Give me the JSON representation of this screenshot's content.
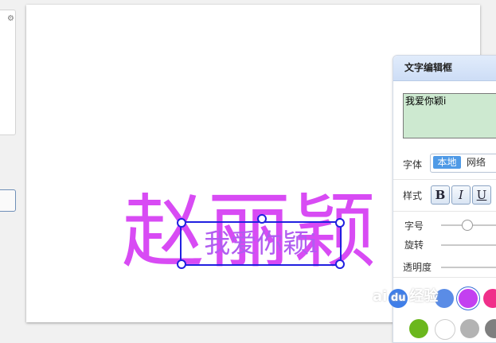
{
  "editor_panel": {
    "title": "文字编辑框",
    "text_value": "我爱你颖i",
    "font_label": "字体",
    "font_local": "本地",
    "font_network": "网络",
    "style_label": "样式",
    "bold_label": "B",
    "italic_label": "I",
    "underline_label": "U",
    "size_label": "字号",
    "rotate_label": "旋转",
    "opacity_label": "透明度"
  },
  "canvas": {
    "background_text": "赵丽颖",
    "selected_text": "我爱你颖i"
  },
  "watermark": {
    "prefix": "ai",
    "du": "du",
    "suffix": "经验"
  },
  "colors": {
    "panel_header": "#cddcf5",
    "textarea_bg": "#cde9d0",
    "selection_border": "#2020e0",
    "background_text": "#d84bf4",
    "selected_text": "#b05df0",
    "swatches": [
      "#5a8ce6",
      "#c340f0",
      "#f02f8a",
      "#6bb71d",
      "#ffffff",
      "#b3b3b3",
      "#7f7f7f"
    ]
  },
  "slider": {
    "font_size_fraction": 0.35
  }
}
